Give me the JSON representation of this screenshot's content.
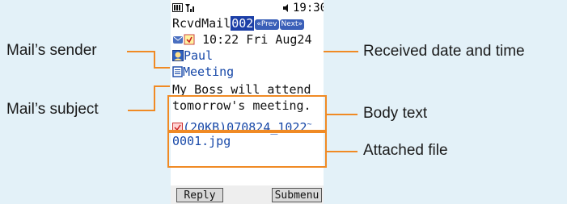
{
  "callouts": {
    "sender": "Mail’s sender",
    "subject": "Mail’s subject",
    "received": "Received date and time",
    "body": "Body text",
    "attached": "Attached file"
  },
  "phone": {
    "status_time": "19:30",
    "title": "RcvdMail",
    "mail_number": "002",
    "prev_label": "Prev",
    "next_label": "Next",
    "received_time": "10:22 Fri Aug24",
    "sender_name": "Paul",
    "subject": "Meeting",
    "body_line1": "My Boss will attend",
    "body_line2": "tomorrow's meeting.",
    "attachment_line1": "(20KB)070824_1022",
    "attachment_line2": "0001.jpg",
    "left_softkey": "Reply",
    "right_softkey": "Submenu"
  },
  "colors": {
    "background": "#e3f1f8",
    "callout_line": "#f08a24",
    "phone_blue": "#1748a8",
    "highlight": "#1c3fa7"
  },
  "icons": [
    "battery-icon",
    "signal-icon",
    "speaker-icon",
    "mail-read-icon",
    "attachment-icon",
    "person-icon",
    "subject-icon",
    "jpeg-file-icon",
    "tilde-mark"
  ]
}
